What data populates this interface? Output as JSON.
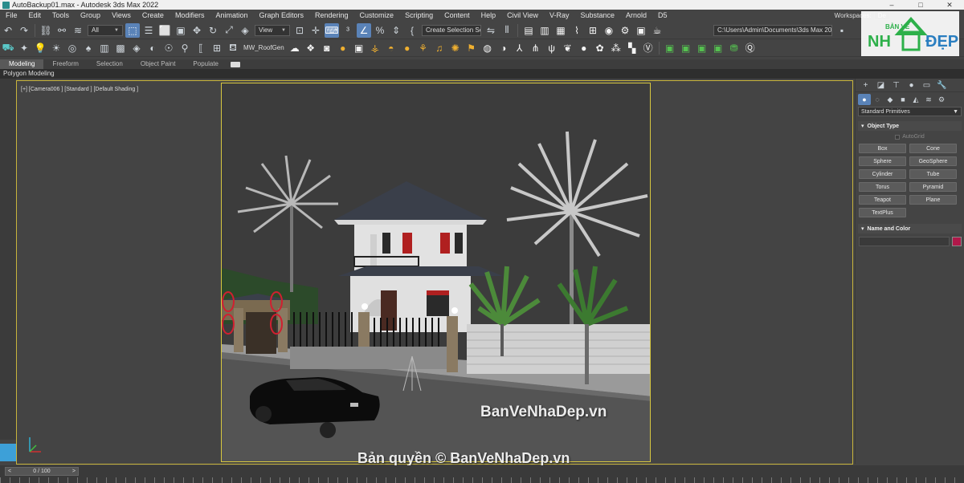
{
  "window": {
    "title": "AutoBackup01.max - Autodesk 3ds Max 2022",
    "controls": [
      "–",
      "□",
      "✕"
    ]
  },
  "menu": {
    "items": [
      "File",
      "Edit",
      "Tools",
      "Group",
      "Views",
      "Create",
      "Modifiers",
      "Animation",
      "Graph Editors",
      "Rendering",
      "Customize",
      "Scripting",
      "Content",
      "Help",
      "Civil View",
      "V-Ray",
      "Substance",
      "Arnold",
      "D5"
    ],
    "workspace_label": "Workspaces:",
    "workspace_value": "De"
  },
  "toolbar1": {
    "filter_value": "All",
    "refcoord_value": "View",
    "selection_set_placeholder": "Create Selection Se",
    "project_path": "C:\\Users\\Admin\\Documents\\3ds Max 2022"
  },
  "toolbar2": {
    "roofgen_label": "MW_RoofGen"
  },
  "ribbon": {
    "tabs": [
      "Modeling",
      "Freeform",
      "Selection",
      "Object Paint",
      "Populate"
    ],
    "active_tab": "Modeling",
    "sub_label": "Polygon Modeling"
  },
  "viewport": {
    "label": "[+] [Camera006 ] [Standard ] [Default Shading ]"
  },
  "command_panel": {
    "category": "Standard Primitives",
    "object_type_title": "Object Type",
    "autogrid_label": "AutoGrid",
    "buttons": [
      "Box",
      "Cone",
      "Sphere",
      "GeoSphere",
      "Cylinder",
      "Tube",
      "Torus",
      "Pyramid",
      "Teapot",
      "Plane",
      "TextPlus"
    ],
    "name_color_title": "Name and Color",
    "object_color": "#b0184a"
  },
  "timeline": {
    "frame_display": "0 / 100",
    "prev_symbol": "<",
    "next_symbol": ">"
  },
  "watermarks": {
    "middle": "BanVeNhaDep.vn",
    "bottom": "Bản quyền © BanVeNhaDep.vn"
  },
  "logo": {
    "top_text": "BẢN VẼ",
    "left_text": "NH",
    "right_text": "ĐẸP"
  },
  "colors": {
    "selection_blue": "#5a83b8",
    "viewport_border": "#d8c840",
    "left_swatch": "#3da0d8"
  }
}
